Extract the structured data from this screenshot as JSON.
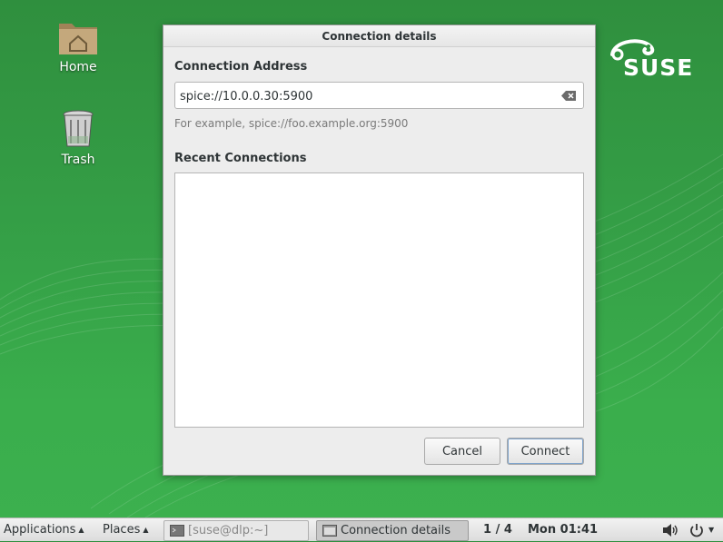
{
  "desktop": {
    "icons": [
      {
        "label": "Home",
        "icon": "home-folder-icon"
      },
      {
        "label": "Trash",
        "icon": "trash-icon"
      }
    ],
    "logo_text": "SUSE"
  },
  "dialog": {
    "title": "Connection details",
    "address_label": "Connection Address",
    "address_value": "spice://10.0.0.30:5900",
    "hint": "For example, spice://foo.example.org:5900",
    "recent_label": "Recent Connections",
    "recent_items": [],
    "cancel_label": "Cancel",
    "connect_label": "Connect"
  },
  "taskbar": {
    "applications_label": "Applications",
    "places_label": "Places",
    "tasks": [
      {
        "label": "[suse@dlp:~]",
        "icon": "terminal-icon",
        "active": false
      },
      {
        "label": "Connection details",
        "icon": "window-icon",
        "active": true
      }
    ],
    "workspace": "1 / 4",
    "clock": "Mon 01:41",
    "volume_icon": "volume-icon",
    "power_icon": "power-icon"
  },
  "colors": {
    "desktop_green": "#35a047",
    "focus_blue": "#7fa4cc"
  }
}
